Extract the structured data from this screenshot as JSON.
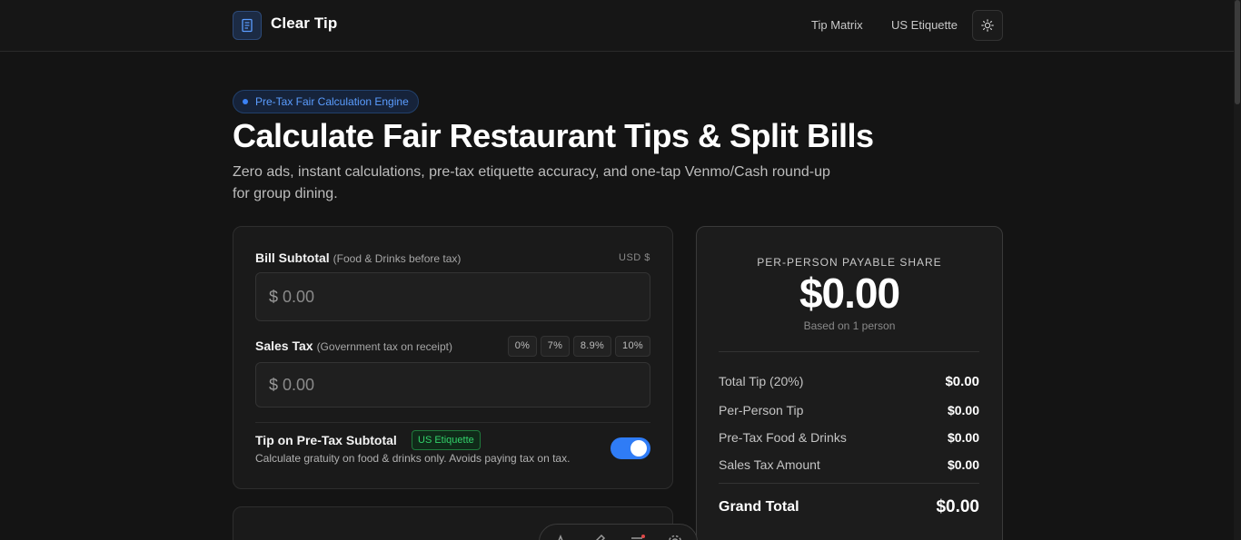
{
  "header": {
    "brand": "Clear Tip",
    "logo_icon": "receipt-icon",
    "nav": [
      {
        "label": "Tip Matrix"
      },
      {
        "label": "US Etiquette"
      }
    ],
    "theme_icon": "sun-icon"
  },
  "hero": {
    "badge": "Pre-Tax Fair Calculation Engine",
    "title": "Calculate Fair Restaurant Tips & Split Bills",
    "subtitle": "Zero ads, instant calculations, pre-tax etiquette accuracy, and one-tap Venmo/Cash round-up for group dining."
  },
  "form": {
    "subtotal": {
      "label": "Bill Subtotal",
      "hint": "(Food & Drinks before tax)",
      "currency": "USD $",
      "prefix": "$",
      "placeholder": "0.00"
    },
    "tax": {
      "label": "Sales Tax",
      "hint": "(Government tax on receipt)",
      "prefix": "$",
      "placeholder": "0.00",
      "presets": [
        "0%",
        "7%",
        "8.9%",
        "10%"
      ]
    },
    "pretax": {
      "label": "Tip on Pre-Tax Subtotal",
      "badge": "US Etiquette",
      "description": "Calculate gratuity on food & drinks only. Avoids paying tax on tax.",
      "enabled": true
    }
  },
  "summary": {
    "caption": "PER-PERSON PAYABLE SHARE",
    "amount": "$0.00",
    "note": "Based on 1 person",
    "rows": [
      {
        "label": "Total Tip (20%)",
        "value": "$0.00"
      },
      {
        "label": "Per-Person Tip",
        "value": "$0.00"
      },
      {
        "label": "Pre-Tax Food & Drinks",
        "value": "$0.00"
      },
      {
        "label": "Sales Tax Amount",
        "value": "$0.00"
      }
    ],
    "grand_label": "Grand Total",
    "grand_value": "$0.00"
  },
  "floating_toolbar": {
    "icons": [
      "text-icon",
      "pen-icon",
      "menu-icon",
      "settings-icon"
    ]
  },
  "colors": {
    "accent": "#2f7cf6",
    "background": "#141414",
    "etiquette_green": "#33d36b"
  }
}
